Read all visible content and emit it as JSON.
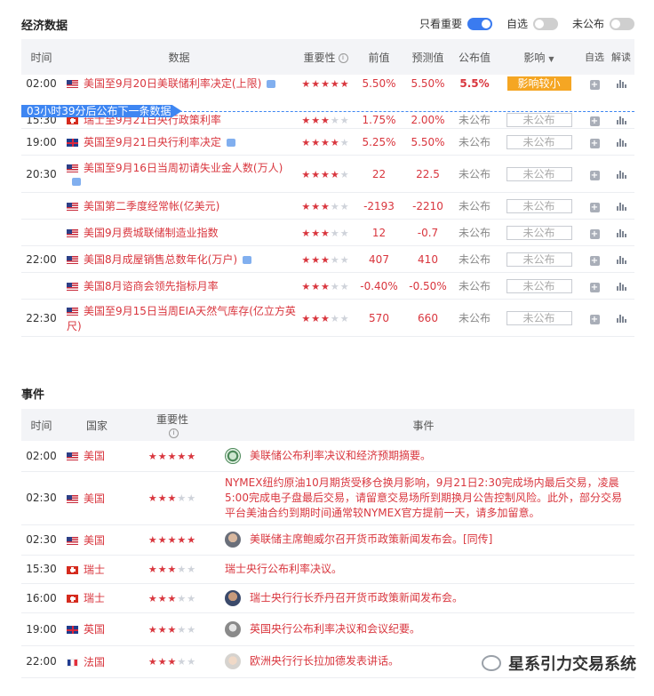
{
  "econ": {
    "title": "经济数据",
    "toggles": [
      {
        "label": "只看重要",
        "on": true
      },
      {
        "label": "自选",
        "on": false
      },
      {
        "label": "未公布",
        "on": false
      }
    ],
    "headers": {
      "time": "时间",
      "data": "数据",
      "importance": "重要性",
      "prev": "前值",
      "forecast": "预测值",
      "actual": "公布值",
      "impact": "影响",
      "watch": "自选",
      "interp": "解读"
    },
    "next_banner": "03小时39分后公布下一条数据",
    "rows": [
      {
        "time": "02:00",
        "flag": "us",
        "name": "美国至9月20日美联储利率决定(上限)",
        "chat": true,
        "stars": 5,
        "prev": "5.50%",
        "forecast": "5.50%",
        "actual": "5.5%",
        "impact": "影响较小",
        "impact_type": "strong"
      },
      {
        "time": "15:30",
        "flag": "ch",
        "name": "瑞士至9月21日央行政策利率",
        "chat": false,
        "stars": 3,
        "prev": "1.75%",
        "forecast": "2.00%",
        "actual": "未公布",
        "impact": "未公布",
        "impact_type": "empty"
      },
      {
        "time": "19:00",
        "flag": "gb",
        "name": "英国至9月21日央行利率决定",
        "chat": true,
        "stars": 4,
        "prev": "5.25%",
        "forecast": "5.50%",
        "actual": "未公布",
        "impact": "未公布",
        "impact_type": "empty"
      },
      {
        "time": "20:30",
        "flag": "us",
        "name": "美国至9月16日当周初请失业金人数(万人)",
        "chat": true,
        "stars": 4,
        "prev": "22",
        "forecast": "22.5",
        "actual": "未公布",
        "impact": "未公布",
        "impact_type": "empty"
      },
      {
        "time": "",
        "flag": "us",
        "name": "美国第二季度经常帐(亿美元)",
        "chat": false,
        "stars": 3,
        "prev": "-2193",
        "forecast": "-2210",
        "actual": "未公布",
        "impact": "未公布",
        "impact_type": "empty"
      },
      {
        "time": "",
        "flag": "us",
        "name": "美国9月费城联储制造业指数",
        "chat": false,
        "stars": 3,
        "prev": "12",
        "forecast": "-0.7",
        "actual": "未公布",
        "impact": "未公布",
        "impact_type": "empty"
      },
      {
        "time": "22:00",
        "flag": "us",
        "name": "美国8月成屋销售总数年化(万户)",
        "chat": true,
        "stars": 3,
        "prev": "407",
        "forecast": "410",
        "actual": "未公布",
        "impact": "未公布",
        "impact_type": "empty"
      },
      {
        "time": "",
        "flag": "us",
        "name": "美国8月谘商会领先指标月率",
        "chat": false,
        "stars": 3,
        "prev": "-0.40%",
        "forecast": "-0.50%",
        "actual": "未公布",
        "impact": "未公布",
        "impact_type": "empty"
      },
      {
        "time": "22:30",
        "flag": "us",
        "name": "美国至9月15日当周EIA天然气库存(亿立方英尺)",
        "chat": false,
        "stars": 3,
        "prev": "570",
        "forecast": "660",
        "actual": "未公布",
        "impact": "未公布",
        "impact_type": "empty"
      }
    ]
  },
  "events": {
    "title": "事件",
    "headers": {
      "time": "时间",
      "country": "国家",
      "importance": "重要性",
      "event": "事件"
    },
    "rows": [
      {
        "time": "02:00",
        "flag": "us",
        "country": "美国",
        "stars": 5,
        "avatar": "seal",
        "text": "美联储公布利率决议和经济预期摘要。"
      },
      {
        "time": "02:30",
        "flag": "us",
        "country": "美国",
        "stars": 3,
        "avatar": "",
        "text": "NYMEX纽约原油10月期货受移仓换月影响，9月21日2:30完成场内最后交易，凌晨5:00完成电子盘最后交易，请留意交易场所到期换月公告控制风险。此外，部分交易平台美油合约到期时间通常较NYMEX官方提前一天，请多加留意。"
      },
      {
        "time": "02:30",
        "flag": "us",
        "country": "美国",
        "stars": 5,
        "avatar": "p1",
        "text": "美联储主席鲍威尔召开货币政策新闻发布会。[同传]"
      },
      {
        "time": "15:30",
        "flag": "ch",
        "country": "瑞士",
        "stars": 3,
        "avatar": "",
        "text": "瑞士央行公布利率决议。"
      },
      {
        "time": "16:00",
        "flag": "ch",
        "country": "瑞士",
        "stars": 3,
        "avatar": "p2",
        "text": "瑞士央行行长乔丹召开货币政策新闻发布会。"
      },
      {
        "time": "19:00",
        "flag": "gb",
        "country": "英国",
        "stars": 3,
        "avatar": "p3",
        "text": "英国央行公布利率决议和会议纪要。"
      },
      {
        "time": "22:00",
        "flag": "fr",
        "country": "法国",
        "stars": 3,
        "avatar": "p4",
        "text": "欧洲央行行长拉加德发表讲话。"
      }
    ]
  },
  "watermark": "星系引力交易系统",
  "colors": {
    "accent": "#3a7bf0",
    "red": "#d9363e",
    "impact_strong": "#f5a623"
  }
}
